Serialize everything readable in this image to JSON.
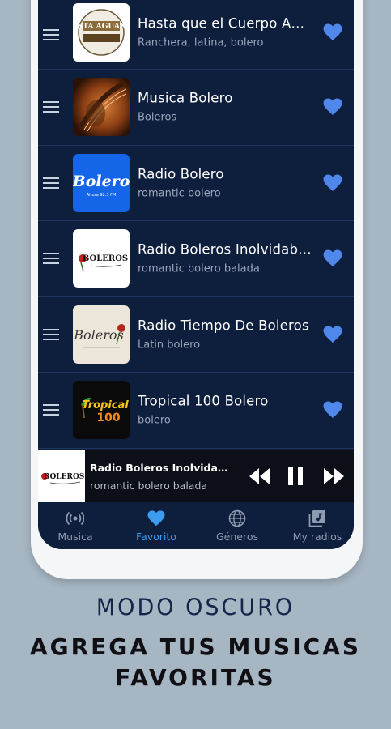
{
  "stations": [
    {
      "title": "Hasta que el Cuerpo Ag...",
      "subtitle": "Ranchera, latina, bolero",
      "logo": "hasta-aguante-logo",
      "logo_text": "HASTA AGUANTE"
    },
    {
      "title": "Musica Bolero",
      "subtitle": "Boleros",
      "logo": "guitar-photo"
    },
    {
      "title": "Radio Bolero",
      "subtitle": "romantic bolero",
      "logo": "bolero-blue-logo",
      "logo_text": "Bolero",
      "logo_subtext": "Altura 92.3 FM"
    },
    {
      "title": "Radio Boleros Inolvidabl...",
      "subtitle": "romantic bolero balada",
      "logo": "boleros-inolvidables-logo",
      "logo_text": "BOLEROS"
    },
    {
      "title": "Radio Tiempo De Boleros",
      "subtitle": "Latin bolero",
      "logo": "tiempo-boleros-logo",
      "logo_text": "Boleros"
    },
    {
      "title": "Tropical 100 Bolero",
      "subtitle": "bolero",
      "logo": "tropical-100-logo",
      "logo_text": "Tropical",
      "logo_subtext": "100"
    }
  ],
  "player": {
    "title": "Radio Boleros Inolvidables",
    "subtitle": "romantic bolero balada",
    "logo_text": "BOLEROS"
  },
  "nav": [
    {
      "label": "Musica",
      "icon": "radio-waves-icon",
      "active": false
    },
    {
      "label": "Favorito",
      "icon": "heart-icon",
      "active": true
    },
    {
      "label": "Géneros",
      "icon": "globe-icon",
      "active": false
    },
    {
      "label": "My radios",
      "icon": "library-music-icon",
      "active": false
    }
  ],
  "caption": {
    "line1": "MODO OSCURO",
    "line2": "AGREGA TUS MUSICAS",
    "line3": "FAVORITAS"
  },
  "colors": {
    "background": "#a7b6c3",
    "screen": "#0e1e3d",
    "heart": "#4f88ea",
    "active_nav": "#3d9cf0"
  }
}
